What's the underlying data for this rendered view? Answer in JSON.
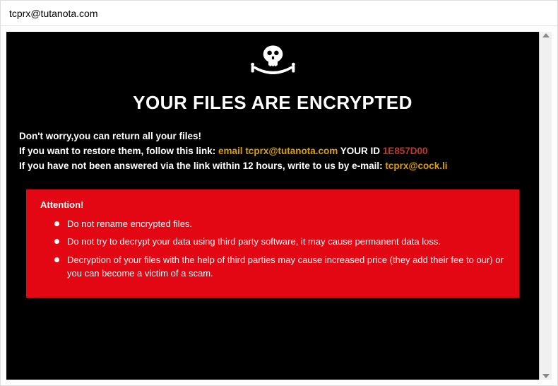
{
  "window": {
    "title": "tcprx@tutanota.com"
  },
  "main": {
    "heading": "YOUR FILES ARE ENCRYPTED",
    "line1": "Don't worry,you can return all your files!",
    "line2_pre": "If you want to restore them, follow this link: ",
    "line2_email_label": "email ",
    "line2_email": "tcprx@tutanota.com",
    "line2_mid": "  YOUR ID ",
    "line2_id": "1E857D00",
    "line3_pre": "If you have not been answered via the link within 12 hours, write to us by e-mail: ",
    "line3_email": "tcprx@cock.li"
  },
  "attention": {
    "title": "Attention!",
    "items": [
      "Do not rename encrypted files.",
      "Do not try to decrypt your data using third party software, it may cause permanent data loss.",
      "Decryption of your files with the help of third parties may cause increased price (they add their fee to our) or you can become a victim of a scam."
    ]
  }
}
